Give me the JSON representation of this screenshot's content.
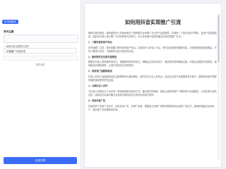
{
  "sidebar": {
    "chip_label": "AI 写作助手",
    "section_title": "写作主题",
    "mode_label": "— 使用当前主题进行创作",
    "topic_value": "抖音推广引流方法",
    "more_link": "更多设置",
    "generate_label": "生成文章"
  },
  "document": {
    "title": "如何用抖音实现推广引流",
    "blocks": [
      {
        "type": "p",
        "text": "随着抖音的普及，越来越多的人开始利用这个短视频平台来推广自己的产品或服务。抖音有一个庞大的用户群体，且用户活跃度极高，因此在抖音上进行推广引流具有很大的潜力。本文将详细介绍如何通过抖音实现推广引流。"
      },
      {
        "type": "h",
        "text": "1、了解抖音的用户特点"
      },
      {
        "type": "p",
        "text": "在开始推广之前，首先需要了解抖音的用户特点。抖音用户以年轻人为主，他们喜欢新鲜有趣的内容，对短视频的接受度很高。只有了解用户喜好，才能制作出吸引他们的内容。"
      },
      {
        "type": "h",
        "text": "2、做好账号定位和内容规划"
      },
      {
        "type": "p",
        "text": "要想在抖音上获得更多的关注，需要做好账号的定位。明确自己的目标用户，确定账号的风格和主题，并制定合理的内容规划，保持稳定的更新频率，让用户持续关注你的账号。"
      },
      {
        "type": "h",
        "text": "3、利用热门话题和挑战"
      },
      {
        "type": "p",
        "text": "抖音上的热门话题和挑战往往能够带来大量的曝光。及时关注平台上的热点，结合自己的产品或服务参与其中，能够有效提升视频的播放量和账号的知名度。"
      },
      {
        "type": "h",
        "text": "4、与网红达人合作"
      },
      {
        "type": "p",
        "text": "与抖音上的网红达人合作是一种快速获取流量的方式。通过他们的推荐，能够让更多的用户了解你的产品或服务，从而实现引流的目的。选择合作对象时要注意其粉丝群体是否与你的目标用户相符。"
      },
      {
        "type": "h",
        "text": "5、利用抖音广告"
      },
      {
        "type": "p",
        "text": "抖音提供了多种广告形式，如信息流广告、开屏广告等。根据自己的推广需求和预算选择合适的广告形式，能够精准触达目标用户，提高推广的效果和转化率。"
      }
    ]
  }
}
